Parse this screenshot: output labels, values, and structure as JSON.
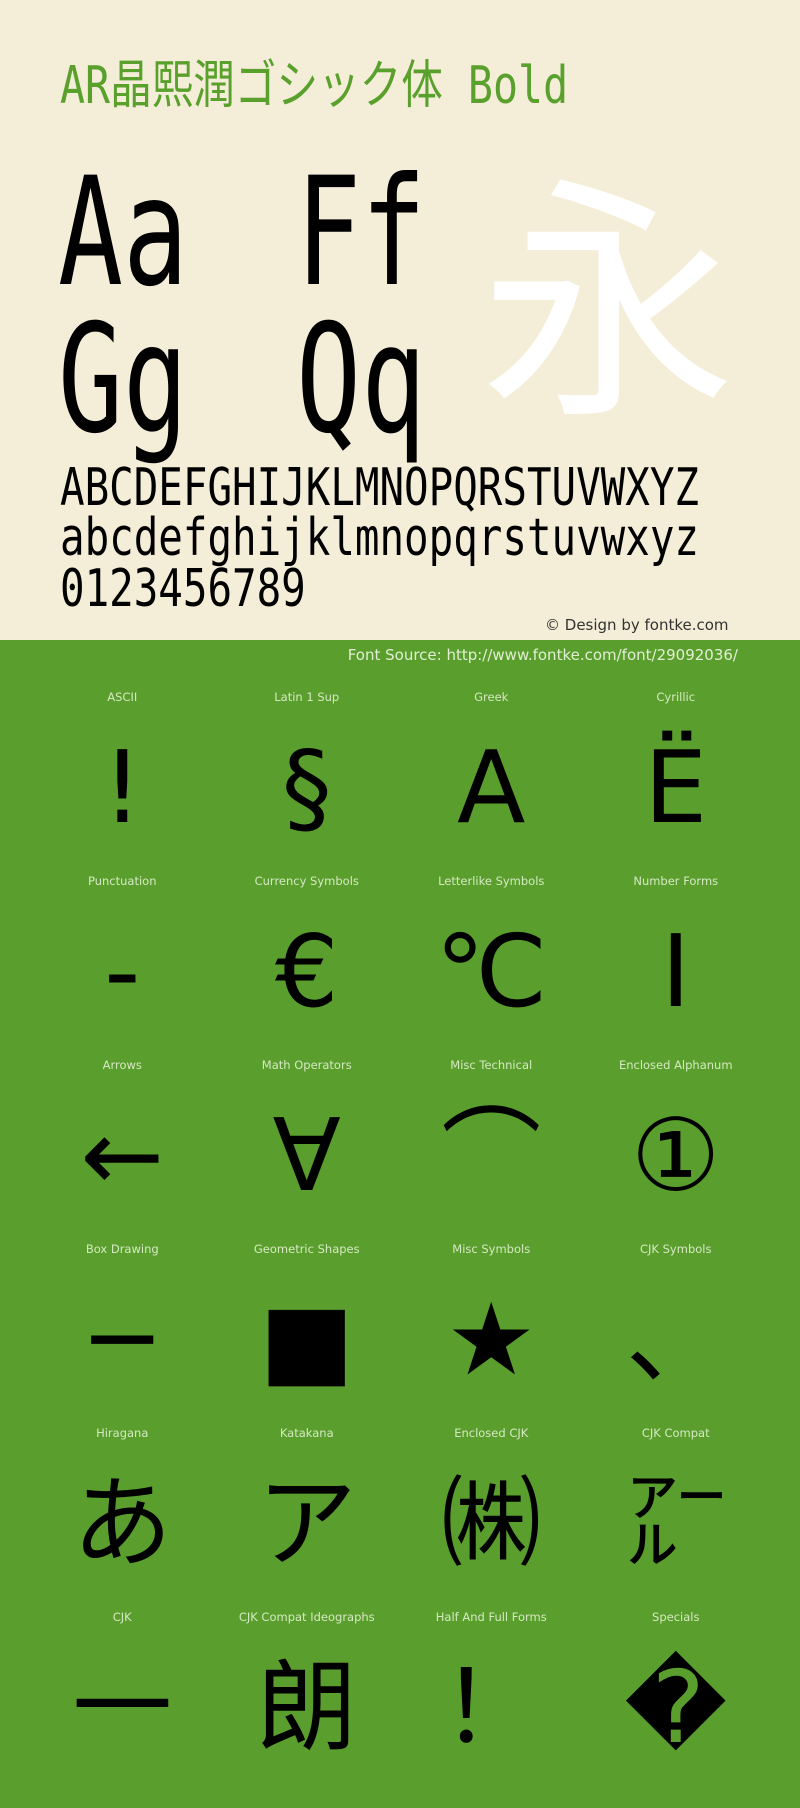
{
  "header": {
    "title": "AR晶熙潤ゴシック体 Bold",
    "colors": {
      "background": "#f4edd8",
      "title": "#5aa02c",
      "showcase_bg": "#5a9f2d"
    }
  },
  "specimen": {
    "pairs": [
      "Aa",
      "Ff",
      "Gg",
      "Qq"
    ],
    "feature_glyph": "永",
    "uppercase": "ABCDEFGHIJKLMNOPQRSTUVWXYZ",
    "lowercase": "abcdefghijklmnopqrstuvwxyz",
    "digits": "0123456789"
  },
  "credits": {
    "copyright": "© Design by fontke.com",
    "source": "Font Source: http://www.fontke.com/font/29092036/"
  },
  "blocks": [
    {
      "label": "ASCII",
      "glyph": "!"
    },
    {
      "label": "Latin 1 Sup",
      "glyph": "§"
    },
    {
      "label": "Greek",
      "glyph": "Α"
    },
    {
      "label": "Cyrillic",
      "glyph": "Ё"
    },
    {
      "label": "Punctuation",
      "glyph": "‐"
    },
    {
      "label": "Currency Symbols",
      "glyph": "€"
    },
    {
      "label": "Letterlike Symbols",
      "glyph": "℃"
    },
    {
      "label": "Number Forms",
      "glyph": "Ⅰ"
    },
    {
      "label": "Arrows",
      "glyph": "←"
    },
    {
      "label": "Math Operators",
      "glyph": "∀"
    },
    {
      "label": "Misc Technical",
      "glyph": "⌒"
    },
    {
      "label": "Enclosed Alphanum",
      "glyph": "①"
    },
    {
      "label": "Box Drawing",
      "glyph": "─"
    },
    {
      "label": "Geometric Shapes",
      "glyph": "■"
    },
    {
      "label": "Misc Symbols",
      "glyph": "★"
    },
    {
      "label": "CJK Symbols",
      "glyph": "、"
    },
    {
      "label": "Hiragana",
      "glyph": "あ"
    },
    {
      "label": "Katakana",
      "glyph": "ア"
    },
    {
      "label": "Enclosed CJK",
      "glyph": "㈱"
    },
    {
      "label": "CJK Compat",
      "glyph": "㌃"
    },
    {
      "label": "CJK",
      "glyph": "一"
    },
    {
      "label": "CJK Compat Ideographs",
      "glyph": "朗"
    },
    {
      "label": "Half And Full Forms",
      "glyph": "！"
    },
    {
      "label": "Specials",
      "glyph": "�"
    }
  ]
}
